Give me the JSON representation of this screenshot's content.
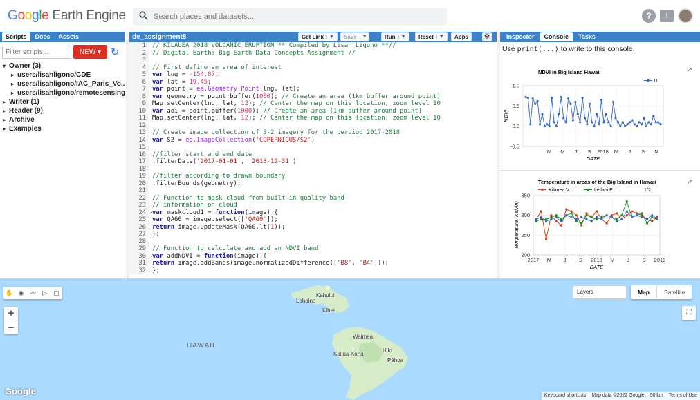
{
  "app": {
    "logo_google": "Google",
    "logo_product": "Earth Engine",
    "search_placeholder": "Search places and datasets...",
    "help_icon": "help-icon",
    "feedback_icon": "feedback-icon"
  },
  "left_panel": {
    "tabs": [
      "Scripts",
      "Docs",
      "Assets"
    ],
    "active_tab": "Scripts",
    "filter_placeholder": "Filter scripts...",
    "new_label": "NEW ▾",
    "tree": [
      {
        "label": "Owner (3)",
        "expanded": true,
        "level": 0
      },
      {
        "label": "users/lisahligono/CDE",
        "level": 1
      },
      {
        "label": "users/lisahligono/IAC_Paris_Vo...",
        "level": 1
      },
      {
        "label": "users/lisahligono/remotesensing",
        "level": 1
      },
      {
        "label": "Writer (1)",
        "level": 0
      },
      {
        "label": "Reader (9)",
        "level": 0
      },
      {
        "label": "Archive",
        "level": 0
      },
      {
        "label": "Examples",
        "level": 0
      }
    ]
  },
  "editor": {
    "title": "de_assignment8",
    "buttons": {
      "get_link": "Get Link",
      "save": "Save",
      "run": "Run",
      "reset": "Reset",
      "apps": "Apps"
    },
    "lines": [
      {
        "n": "1",
        "t": "// KILAUEA 2018 VOLCANIC ERUPTION ** Compiled by Lisah Ligono **//"
      },
      {
        "n": "2",
        "t": "// Digital Earth: Big Earth Data Concepts Assignment //"
      },
      {
        "n": "3",
        "t": ""
      },
      {
        "n": "4",
        "t": "// First define an area of interest"
      },
      {
        "n": "5",
        "t": "var lng = -154.87;"
      },
      {
        "n": "6",
        "t": "var lat = 19.45;"
      },
      {
        "n": "7",
        "t": "var point = ee.Geometry.Point(lng, lat);"
      },
      {
        "n": "8",
        "t": "var geometry = point.buffer(1000); // Create an area (1km buffer around point)"
      },
      {
        "n": "9",
        "t": "Map.setCenter(lng, lat, 12); // Center the map on this location, zoom level 10"
      },
      {
        "n": "10",
        "t": "var aoi = point.buffer(1000); // Create an area (1km buffer around point)"
      },
      {
        "n": "11",
        "t": "Map.setCenter(lng, lat, 12); // Center the map on this location, zoom level 10"
      },
      {
        "n": "12",
        "t": ""
      },
      {
        "n": "13",
        "t": "// Create image collection of S-2 imagery for the perdiod 2017-2018"
      },
      {
        "n": "14",
        "t": "var S2 = ee.ImageCollection('COPERNICUS/S2')"
      },
      {
        "n": "15",
        "t": ""
      },
      {
        "n": "16",
        "t": "//filter start and end date"
      },
      {
        "n": "17",
        "t": ".filterDate('2017-01-01', '2018-12-31')"
      },
      {
        "n": "18",
        "t": ""
      },
      {
        "n": "19",
        "t": "//filter according to drawn boundary"
      },
      {
        "n": "20",
        "t": ".filterBounds(geometry);"
      },
      {
        "n": "21",
        "t": ""
      },
      {
        "n": "22",
        "t": "// Function to mask cloud from built-in quality band"
      },
      {
        "n": "23",
        "t": "// information on cloud"
      },
      {
        "n": "24",
        "t": "var maskcloud1 = function(image) {"
      },
      {
        "n": "25",
        "t": "var QA60 = image.select(['QA60']);"
      },
      {
        "n": "26",
        "t": "return image.updateMask(QA60.lt(1));"
      },
      {
        "n": "27",
        "t": "};"
      },
      {
        "n": "28",
        "t": ""
      },
      {
        "n": "29",
        "t": "// Function to calculate and add an NDVI band"
      },
      {
        "n": "30",
        "t": "var addNDVI = function(image) {"
      },
      {
        "n": "31",
        "t": "return image.addBands(image.normalizedDifference(['B8', 'B4']));"
      },
      {
        "n": "32",
        "t": "};"
      }
    ]
  },
  "right_panel": {
    "tabs": [
      "Inspector",
      "Console",
      "Tasks"
    ],
    "active_tab": "Console",
    "console_pre": "Use ",
    "console_code": "print(...)",
    "console_post": " to write to this console."
  },
  "chart_data": [
    {
      "type": "line",
      "title": "NDVI in Big Island Hawaii",
      "xlabel": "DATE",
      "ylabel": "NDVI",
      "ylim": [
        -0.5,
        1.0
      ],
      "yticks": [
        "1.0",
        "0.5",
        "0.0",
        "-0.5"
      ],
      "xticks": [
        "M",
        "M",
        "J",
        "S",
        "2018",
        "M",
        "J",
        "S",
        "N"
      ],
      "legend": [
        "0"
      ],
      "series": [
        {
          "name": "0",
          "color": "#3366cc",
          "values": [
            0.72,
            0.7,
            0.05,
            0.68,
            0.55,
            0.62,
            0.05,
            0.3,
            0.0,
            0.05,
            0.0,
            0.7,
            0.1,
            0.0,
            0.3,
            0.72,
            0.2,
            0.1,
            0.68,
            0.55,
            0.15,
            0.6,
            0.3,
            0.1,
            0.7,
            0.2,
            0.05,
            0.55,
            0.1,
            0.0,
            0.3,
            0.05,
            0.65,
            0.1,
            0.3,
            0.1,
            0.0,
            0.6,
            0.2,
            0.1,
            0.0,
            0.1,
            0.0,
            0.05,
            0.1,
            0.15,
            0.05,
            0.0,
            0.1,
            0.05,
            0.2,
            0.0,
            0.1,
            0.05,
            0.25,
            0.1,
            0.1,
            0.05
          ]
        }
      ]
    },
    {
      "type": "line",
      "title": "Temperature in areas of the Big Island in Hawaii",
      "xlabel": "DATE",
      "ylabel": "Temperature (Kelvin)",
      "ylim": [
        200,
        350
      ],
      "yticks": [
        "350",
        "300",
        "250",
        "200"
      ],
      "xticks": [
        "2017",
        "M",
        "J",
        "S",
        "2018",
        "M",
        "J",
        "S",
        "2019"
      ],
      "legend": [
        "Kilauea V...",
        "Leilani E..."
      ],
      "legend_page": "1/2",
      "series": [
        {
          "name": "Kilauea V...",
          "color": "#dc3912",
          "values": [
            290,
            310,
            240,
            300,
            285,
            275,
            315,
            310,
            300,
            275,
            305,
            295,
            310,
            290,
            280,
            300,
            305,
            290,
            300,
            310,
            305,
            300,
            290,
            285,
            295
          ]
        },
        {
          "name": "Leilani E...",
          "color": "#109618",
          "values": [
            285,
            290,
            290,
            295,
            300,
            290,
            300,
            305,
            285,
            280,
            300,
            295,
            290,
            295,
            300,
            295,
            290,
            300,
            335,
            295,
            300,
            305,
            280,
            295,
            290
          ]
        },
        {
          "name": "",
          "color": "#3366cc",
          "values": [
            290,
            295,
            285,
            290,
            295,
            285,
            300,
            295,
            290,
            295,
            290,
            285,
            295,
            290,
            300,
            295,
            285,
            290,
            310,
            295,
            300,
            295,
            290,
            300,
            292
          ]
        }
      ]
    }
  ],
  "map": {
    "layers_label": "Layers",
    "map_label": "Map",
    "satellite_label": "Satellite",
    "region_label": "HAWAII",
    "places": [
      "Kahului",
      "Lahaina",
      "Kihei",
      "Waimea",
      "Hilo",
      "Kailua-Kona",
      "Pāhoa"
    ],
    "attribution": [
      "Keyboard shortcuts",
      "Map data ©2022 Google",
      "50 km",
      "Terms of Use"
    ],
    "google_label": "Google"
  }
}
